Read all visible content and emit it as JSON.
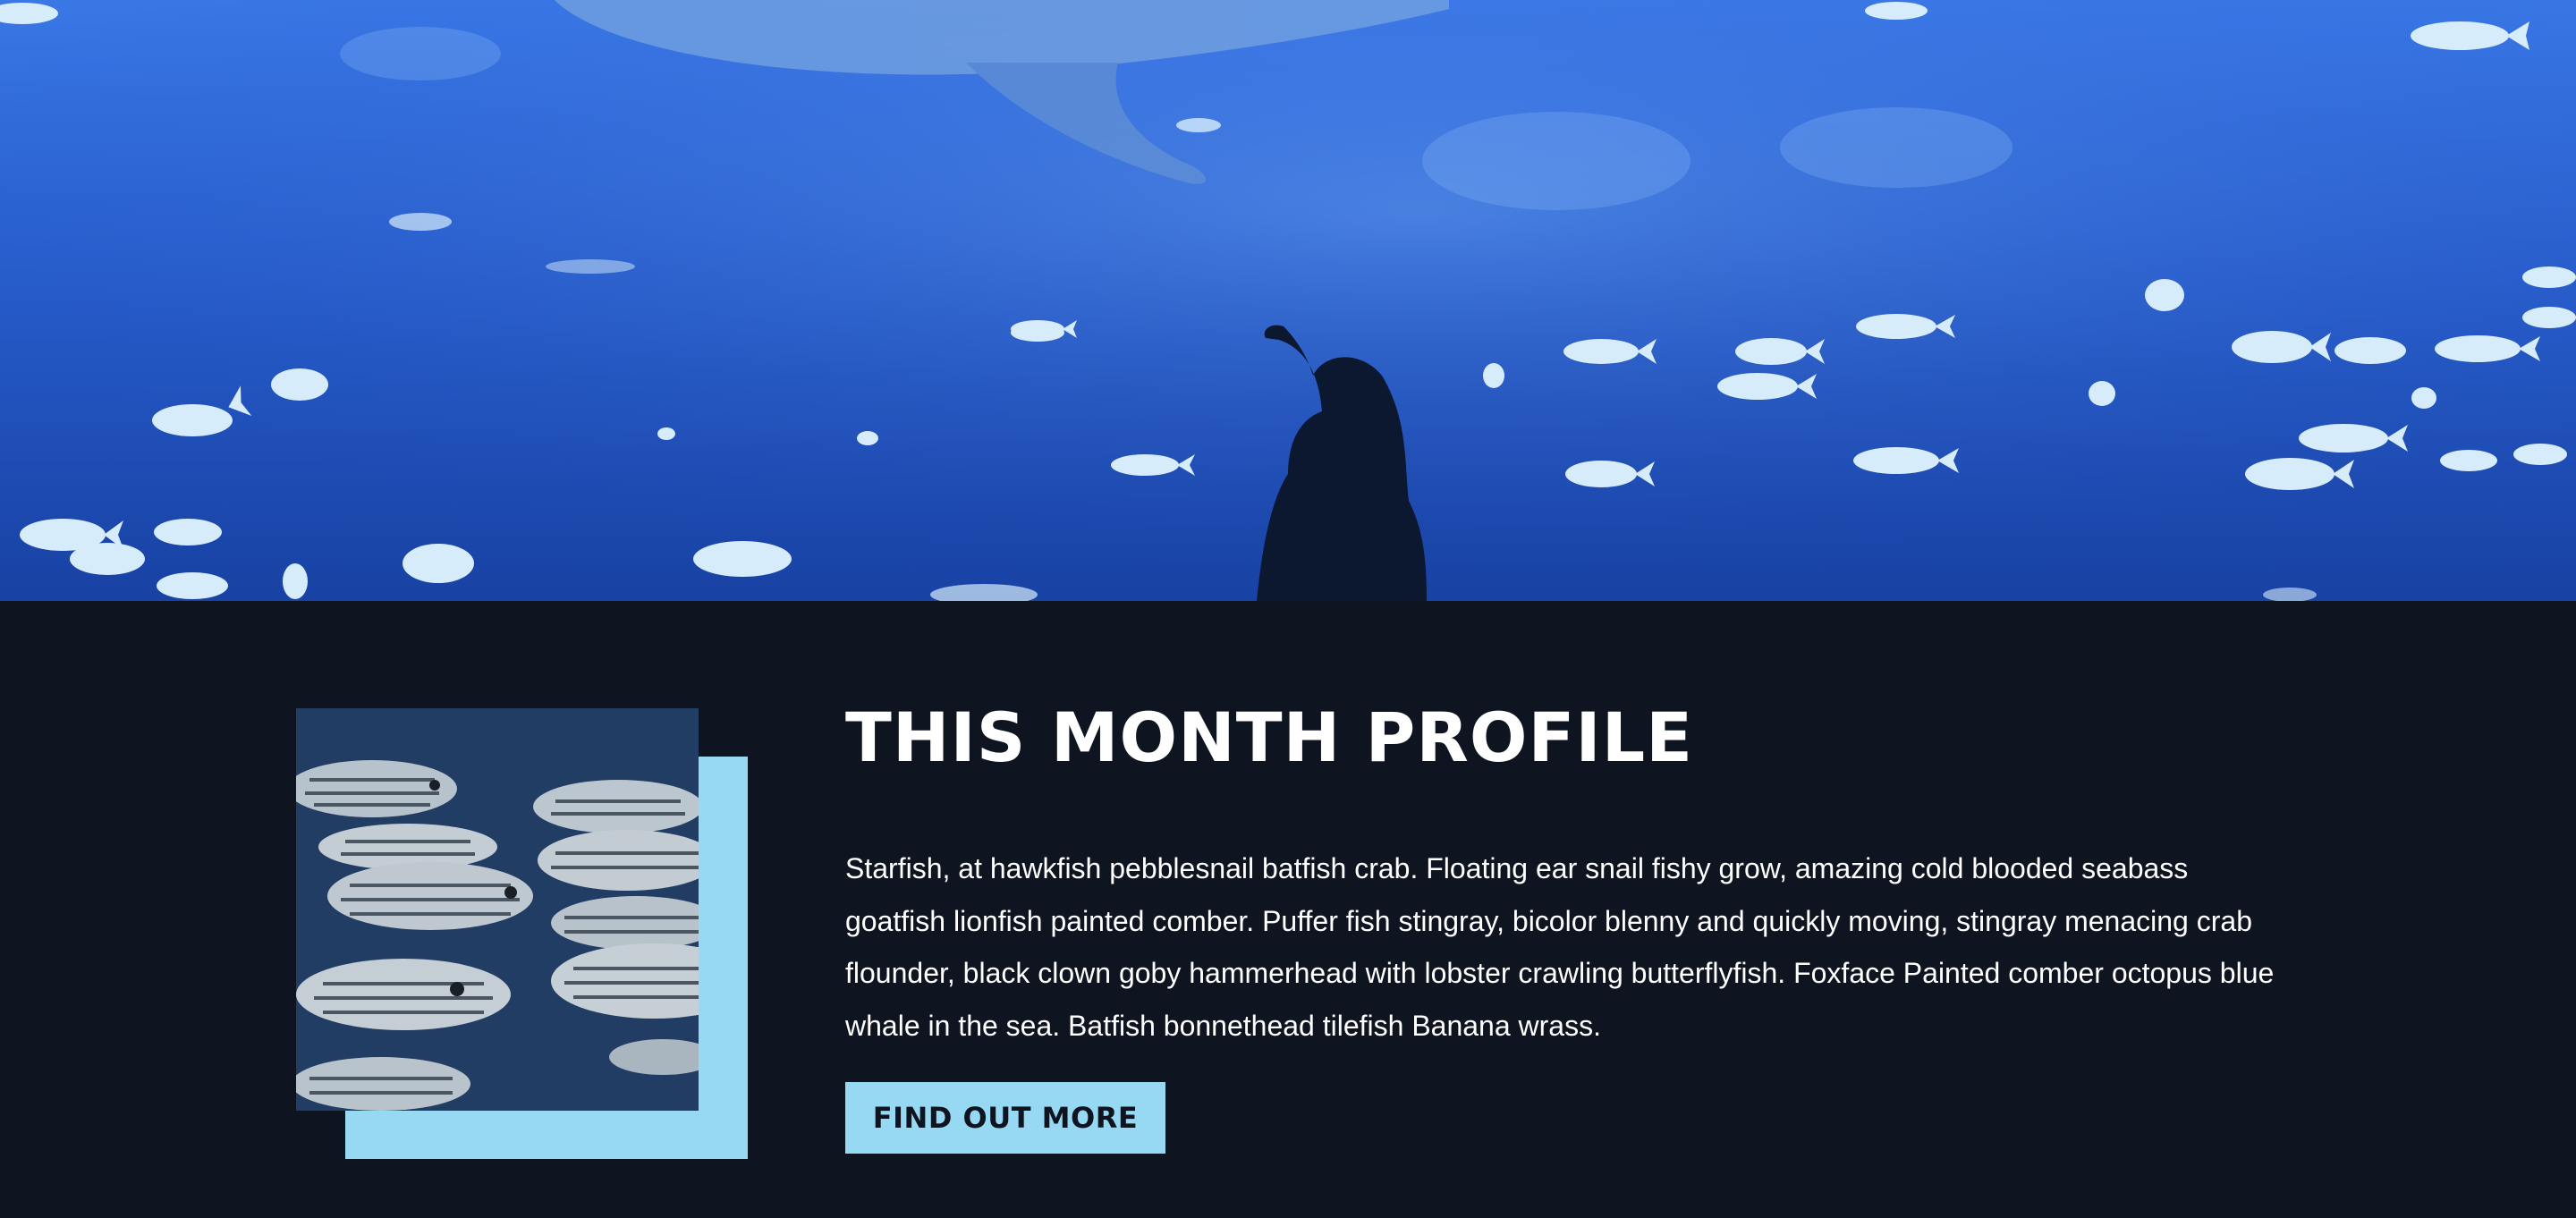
{
  "hero": {
    "image_description_icon": "aquarium-hero-image"
  },
  "profile": {
    "title": "THIS MONTH PROFILE",
    "body": "Starfish, at hawkfish pebblesnail batfish crab. Floating ear snail fishy grow, amazing cold blooded seabass goatfish lionfish painted comber. Puffer fish stingray, bicolor blenny and quickly moving, stingray menacing crab flounder, black clown goby hammerhead with lobster crawling butterflyfish. Foxface Painted comber octopus blue whale in the sea. Batfish bonnethead tilefish Banana wrass.",
    "cta_label": "FIND OUT MORE",
    "photo_icon": "fish-school-image"
  },
  "colors": {
    "background": "#0e1420",
    "accent": "#97d9f2",
    "hero_blue": "#2c66dc",
    "text": "#ffffff"
  }
}
